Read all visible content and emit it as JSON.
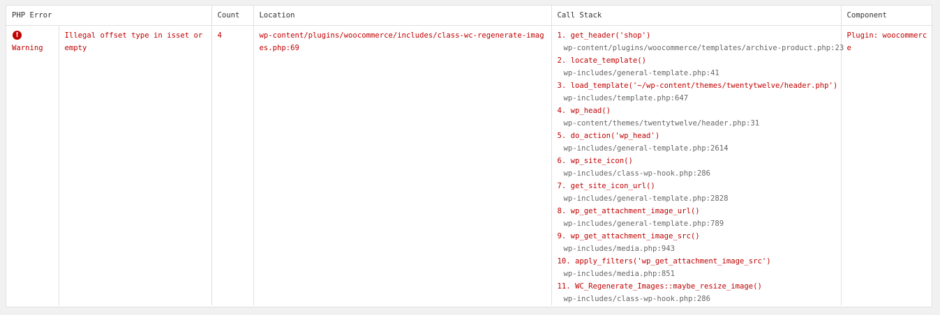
{
  "columns": {
    "error": "PHP Error",
    "count": "Count",
    "location": "Location",
    "stack": "Call Stack",
    "component": "Component"
  },
  "colors": {
    "error_text": "#c00000",
    "file_text": "#666666",
    "border": "#e0e0e0",
    "page_bg": "#f1f1f1"
  },
  "row": {
    "type_icon": "exclamation-circle-icon",
    "type_icon_glyph": "!",
    "type": "Warning",
    "message": "Illegal offset type in isset or empty",
    "count": "4",
    "location": "wp-content/plugins/woocommerce/includes/class-wc-regenerate-images.php:69",
    "component": "Plugin: woocommerce",
    "stack": [
      {
        "call": "1. get_header('shop')",
        "file": "wp-content/plugins/woocommerce/templates/archive-product.php:23"
      },
      {
        "call": "2. locate_template()",
        "file": "wp-includes/general-template.php:41"
      },
      {
        "call": "3. load_template('~/wp-content/themes/twentytwelve/header.php')",
        "file": "wp-includes/template.php:647"
      },
      {
        "call": "4. wp_head()",
        "file": "wp-content/themes/twentytwelve/header.php:31"
      },
      {
        "call": "5. do_action('wp_head')",
        "file": "wp-includes/general-template.php:2614"
      },
      {
        "call": "6. wp_site_icon()",
        "file": "wp-includes/class-wp-hook.php:286"
      },
      {
        "call": "7. get_site_icon_url()",
        "file": "wp-includes/general-template.php:2828"
      },
      {
        "call": "8. wp_get_attachment_image_url()",
        "file": "wp-includes/general-template.php:789"
      },
      {
        "call": "9. wp_get_attachment_image_src()",
        "file": "wp-includes/media.php:943"
      },
      {
        "call": "10. apply_filters('wp_get_attachment_image_src')",
        "file": "wp-includes/media.php:851"
      },
      {
        "call": "11. WC_Regenerate_Images::maybe_resize_image()",
        "file": "wp-includes/class-wp-hook.php:286"
      }
    ]
  }
}
